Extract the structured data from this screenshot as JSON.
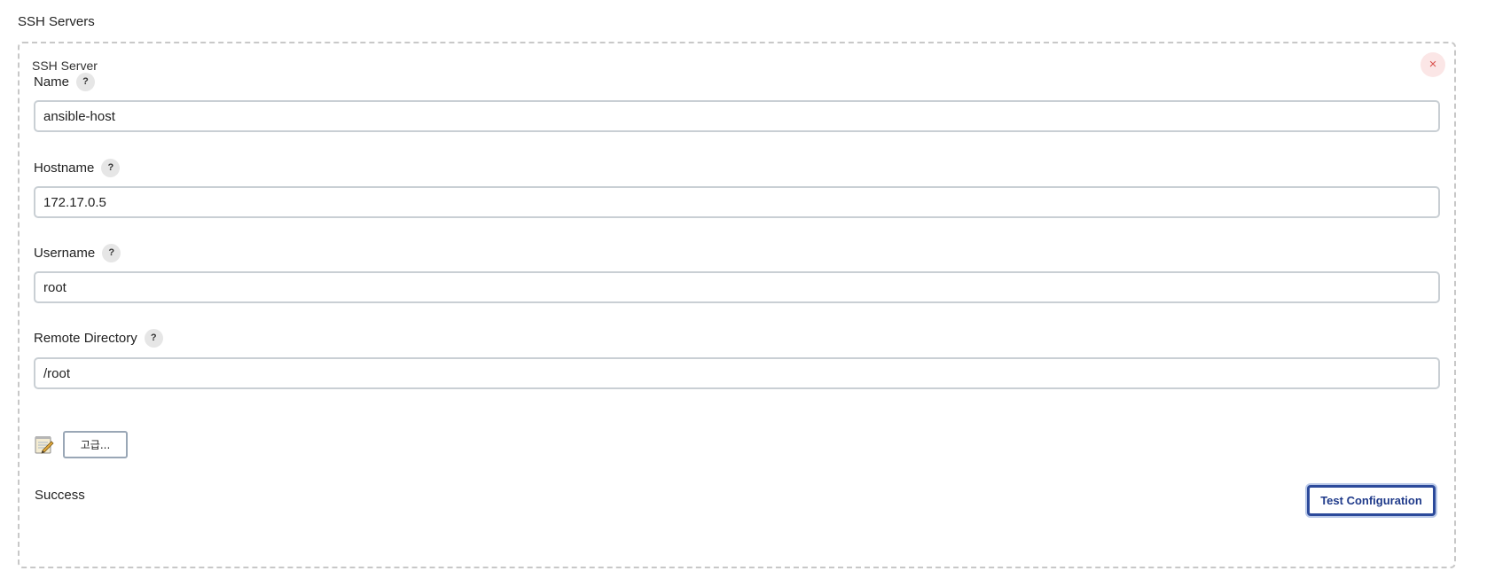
{
  "section": {
    "title": "SSH Servers"
  },
  "server": {
    "header": "SSH Server",
    "close_label": "×",
    "fields": [
      {
        "label": "Name",
        "help": "?",
        "value": "ansible-host"
      },
      {
        "label": "Hostname",
        "help": "?",
        "value": "172.17.0.5"
      },
      {
        "label": "Username",
        "help": "?",
        "value": "root"
      },
      {
        "label": "Remote Directory",
        "help": "?",
        "value": "/root"
      }
    ],
    "advanced_icon": "notepad-pencil-icon",
    "advanced_label": "고급...",
    "status": "Success",
    "test_label": "Test Configuration"
  },
  "colors": {
    "accent": "#2c4a9b",
    "close": "#d9534f",
    "close_bg": "#fbe6e6",
    "border": "#c8c8c8"
  }
}
